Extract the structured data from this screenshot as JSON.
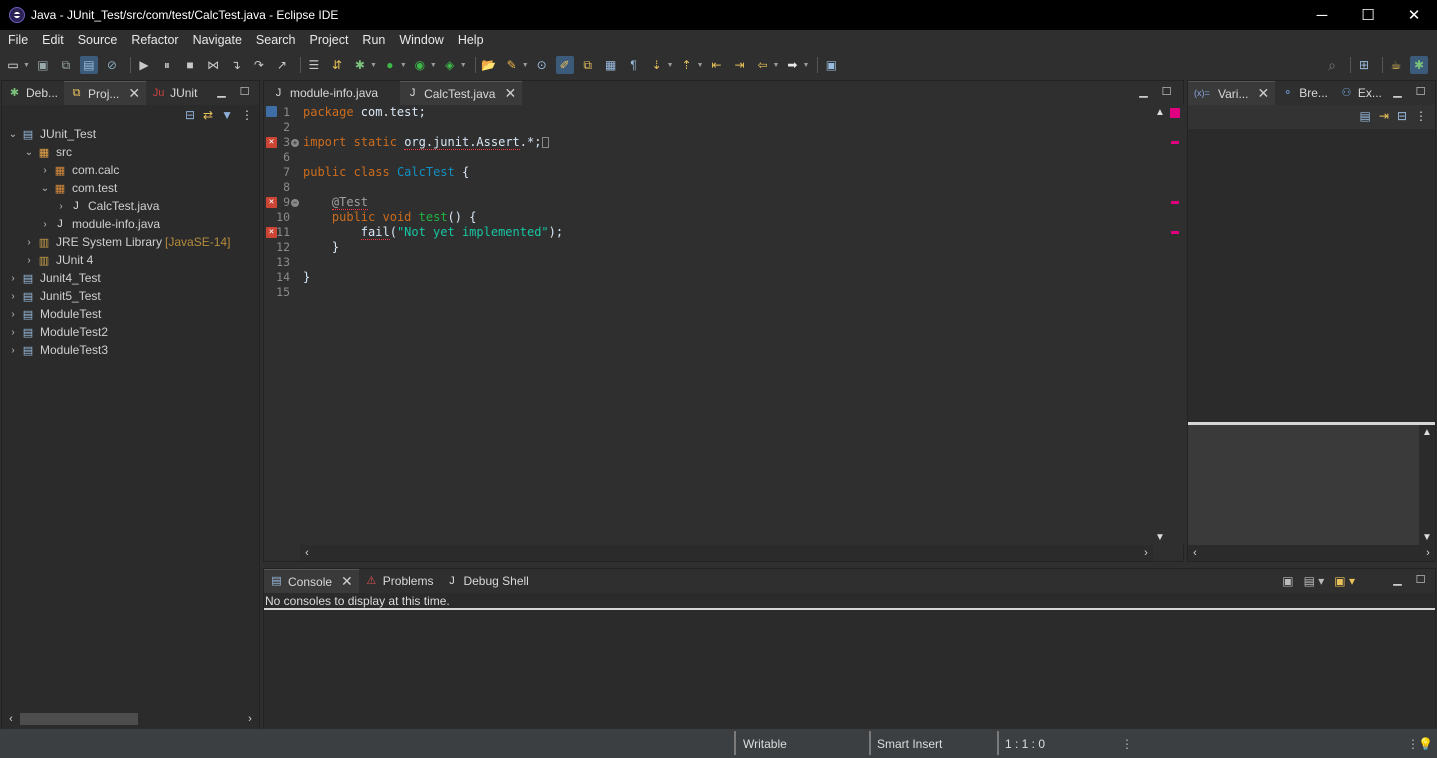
{
  "window": {
    "title": "Java - JUnit_Test/src/com/test/CalcTest.java - Eclipse IDE",
    "controls": {
      "minimize": "─",
      "maximize": "☐",
      "close": "✕"
    }
  },
  "menu": [
    "File",
    "Edit",
    "Source",
    "Refactor",
    "Navigate",
    "Search",
    "Project",
    "Run",
    "Window",
    "Help"
  ],
  "left_panel": {
    "tabs": [
      {
        "label": "Deb..."
      },
      {
        "label": "Proj..."
      },
      {
        "label": "JUnit"
      }
    ],
    "tree": [
      {
        "label": "JUnit_Test"
      },
      {
        "label": "src"
      },
      {
        "label": "com.calc"
      },
      {
        "label": "com.test"
      },
      {
        "label": "CalcTest.java"
      },
      {
        "label": "module-info.java"
      },
      {
        "label": "JRE System Library",
        "decoration": "[JavaSE-14]"
      },
      {
        "label": "JUnit 4"
      },
      {
        "label": "Junit4_Test"
      },
      {
        "label": "Junit5_Test"
      },
      {
        "label": "ModuleTest"
      },
      {
        "label": "ModuleTest2"
      },
      {
        "label": "ModuleTest3"
      }
    ]
  },
  "editor": {
    "tabs": [
      {
        "label": "module-info.java"
      },
      {
        "label": "CalcTest.java"
      }
    ],
    "line_numbers": [
      "1",
      "2",
      "3",
      "6",
      "7",
      "8",
      "9",
      "10",
      "11",
      "12",
      "13",
      "14",
      "15"
    ],
    "lines": {
      "l1_kw": "package",
      "l1_rest": " com.test;",
      "l3_kw1": "import",
      "l3_kw2": "static",
      "l3_rest": "org.junit.Assert",
      "l3_tail": ".*;",
      "l7_kw1": "public",
      "l7_kw2": "class",
      "l7_cls": "CalcTest",
      "l7_tail": " {",
      "l9_ann": "@Test",
      "l10_kw1": "public",
      "l10_kw2": "void",
      "l10_m": "test",
      "l10_tail": "() {",
      "l11_m": "fail",
      "l11_open": "(",
      "l11_str": "\"Not yet implemented\"",
      "l11_tail": ");",
      "l12": "    }",
      "l14": "}"
    }
  },
  "right_panel": {
    "tabs": [
      {
        "label": "Vari..."
      },
      {
        "label": "Bre..."
      },
      {
        "label": "Ex..."
      }
    ]
  },
  "bottom_panel": {
    "tabs": [
      {
        "label": "Console"
      },
      {
        "label": "Problems"
      },
      {
        "label": "Debug Shell"
      }
    ],
    "message": "No consoles to display at this time."
  },
  "status": {
    "writable": "Writable",
    "insert_mode": "Smart Insert",
    "position": "1 : 1 : 0"
  },
  "colors": {
    "keyword": "#cc6c1d",
    "class": "#1290c3",
    "method": "#1eb540",
    "string": "#17c6a3",
    "error_marker": "#e0007f"
  }
}
